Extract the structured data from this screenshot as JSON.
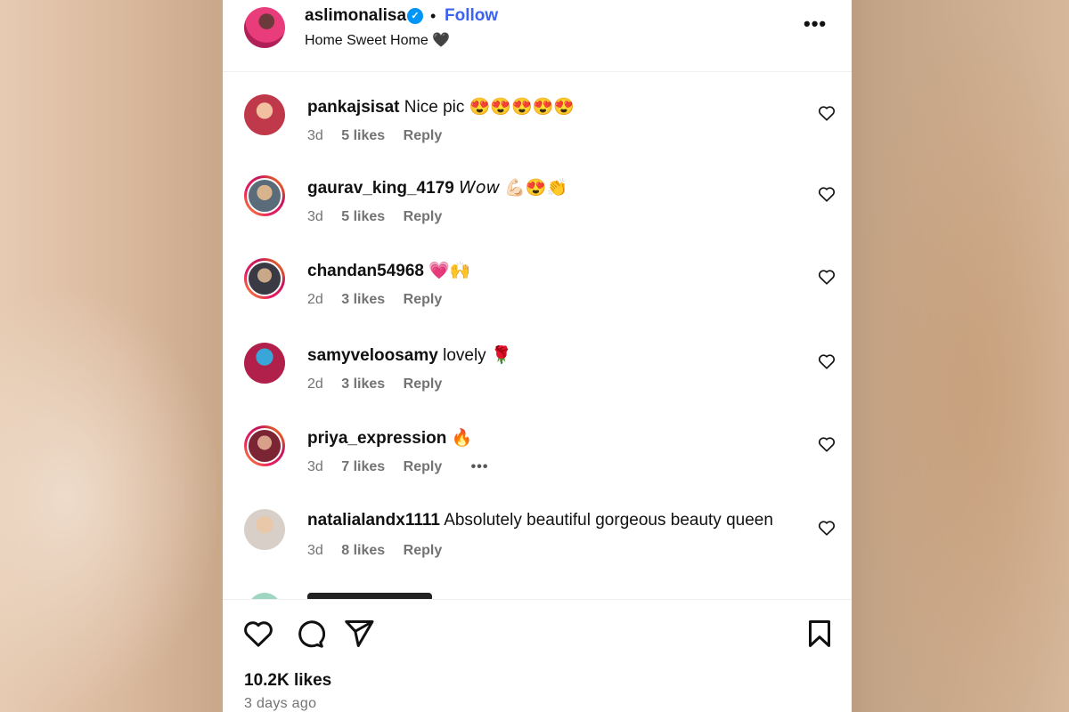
{
  "post": {
    "username": "aslimonalisa",
    "follow_label": "Follow",
    "separator": "•",
    "caption": "Home Sweet Home 🖤",
    "more_label": "•••"
  },
  "comments": [
    {
      "username": "pankajsisat",
      "text": "Nice pic 😍😍😍😍😍",
      "age": "3d",
      "likes": "5 likes",
      "reply": "Reply"
    },
    {
      "username": "gaurav_king_4179",
      "text": "𝘞𝘰𝘸 💪🏻😍👏",
      "age": "3d",
      "likes": "5 likes",
      "reply": "Reply"
    },
    {
      "username": "chandan54968",
      "text": "💗🙌",
      "age": "2d",
      "likes": "3 likes",
      "reply": "Reply"
    },
    {
      "username": "samyveloosamy",
      "text": "lovely 🌹",
      "age": "2d",
      "likes": "3 likes",
      "reply": "Reply"
    },
    {
      "username": "priya_expression",
      "text": "🔥",
      "age": "3d",
      "likes": "7 likes",
      "reply": "Reply",
      "more": "•••"
    },
    {
      "username": "natalialandx1111",
      "text": "Absolutely beautiful gorgeous beauty queen",
      "age": "3d",
      "likes": "8 likes",
      "reply": "Reply"
    }
  ],
  "stats": {
    "likes": "10.2K likes",
    "time_ago": "3 days ago"
  },
  "colors": {
    "follow": "#3a63f0",
    "verified": "#0095f6",
    "meta": "#737373"
  },
  "icons": [
    "verified-badge-icon",
    "more-icon",
    "heart-icon",
    "comment-icon",
    "share-icon",
    "bookmark-icon"
  ]
}
